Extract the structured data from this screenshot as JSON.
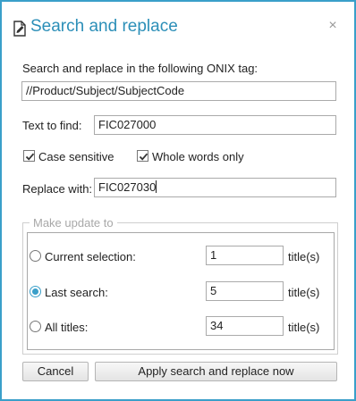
{
  "dialog": {
    "title": "Search and replace",
    "title_icon": "document-edit-icon",
    "close_glyph": "×"
  },
  "tag": {
    "label": "Search and replace in the following ONIX tag:",
    "value": "//Product/Subject/SubjectCode"
  },
  "find": {
    "label": "Text to find:",
    "value": "FIC027000"
  },
  "options": {
    "case_sensitive": {
      "label": "Case sensitive",
      "checked": true
    },
    "whole_words": {
      "label": "Whole words only",
      "checked": true
    }
  },
  "replace": {
    "label": "Replace with:",
    "value": "FIC027030"
  },
  "update": {
    "legend": "Make update to",
    "rows": [
      {
        "label": "Current selection:",
        "count": "1",
        "unit": "title(s)",
        "selected": false
      },
      {
        "label": "Last search:",
        "count": "5",
        "unit": "title(s)",
        "selected": true
      },
      {
        "label": "All titles:",
        "count": "34",
        "unit": "title(s)",
        "selected": false
      }
    ]
  },
  "buttons": {
    "cancel": "Cancel",
    "apply": "Apply search and replace now"
  },
  "colors": {
    "accent": "#3a9fc9",
    "title": "#2c8fb8"
  }
}
